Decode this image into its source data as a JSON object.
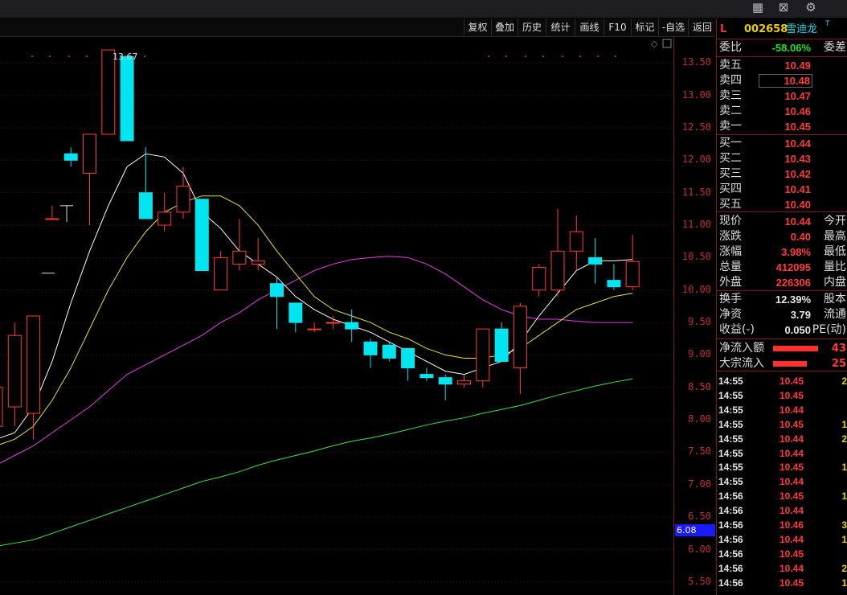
{
  "window": {
    "icons": [
      "grid-icon",
      "chart-icon",
      "settings-icon"
    ]
  },
  "toolbar": {
    "items": [
      "复权",
      "叠加",
      "历史",
      "统计",
      "画线",
      "F10",
      "标记",
      "-自选",
      "返回"
    ]
  },
  "chart": {
    "y_ticks": [
      "13.50",
      "13.00",
      "12.50",
      "12.00",
      "11.50",
      "11.00",
      "10.50",
      "10.00",
      "9.50",
      "9.00",
      "8.50",
      "8.00",
      "7.50",
      "7.00",
      "6.50",
      "6.00",
      "5.50"
    ],
    "max_label": "13.67",
    "crosshair_value": "6.08",
    "colors": {
      "up": "#ff3c3c",
      "down": "#00e5f0",
      "ma5": "#ffffff",
      "ma10": "#e8e040",
      "ma20": "#e040e0",
      "ma60": "#40e040"
    }
  },
  "chart_data": {
    "type": "candlestick",
    "ylim": [
      5.3,
      13.9
    ],
    "candles": [
      {
        "o": 7.9,
        "c": 8.5,
        "h": 8.8,
        "l": 7.8
      },
      {
        "o": 8.2,
        "c": 9.3,
        "h": 9.5,
        "l": 7.9
      },
      {
        "o": 8.1,
        "c": 9.6,
        "h": 9.6,
        "l": 7.7
      },
      {
        "o": 11.1,
        "c": 11.1,
        "h": 11.3,
        "l": 11.1
      },
      {
        "o": 12.1,
        "c": 12.0,
        "h": 12.2,
        "l": 11.9
      },
      {
        "o": 11.8,
        "c": 12.4,
        "h": 12.4,
        "l": 11.0
      },
      {
        "o": 12.4,
        "c": 13.7,
        "h": 13.7,
        "l": 12.4
      },
      {
        "o": 13.6,
        "c": 12.3,
        "h": 13.6,
        "l": 12.3
      },
      {
        "o": 11.5,
        "c": 11.1,
        "h": 12.2,
        "l": 11.1
      },
      {
        "o": 11.0,
        "c": 11.2,
        "h": 11.5,
        "l": 10.9
      },
      {
        "o": 11.2,
        "c": 11.6,
        "h": 11.9,
        "l": 11.1
      },
      {
        "o": 11.4,
        "c": 10.3,
        "h": 11.4,
        "l": 10.3
      },
      {
        "o": 10.0,
        "c": 10.5,
        "h": 10.6,
        "l": 10.0
      },
      {
        "o": 10.4,
        "c": 10.6,
        "h": 11.1,
        "l": 10.3
      },
      {
        "o": 10.4,
        "c": 10.45,
        "h": 10.8,
        "l": 10.3
      },
      {
        "o": 10.1,
        "c": 9.9,
        "h": 10.2,
        "l": 9.4
      },
      {
        "o": 9.8,
        "c": 9.5,
        "h": 9.8,
        "l": 9.35
      },
      {
        "o": 9.4,
        "c": 9.4,
        "h": 9.5,
        "l": 9.35
      },
      {
        "o": 9.5,
        "c": 9.5,
        "h": 9.6,
        "l": 9.4
      },
      {
        "o": 9.5,
        "c": 9.4,
        "h": 9.7,
        "l": 9.2
      },
      {
        "o": 9.2,
        "c": 9.0,
        "h": 9.25,
        "l": 8.8
      },
      {
        "o": 9.15,
        "c": 8.95,
        "h": 9.2,
        "l": 8.9
      },
      {
        "o": 9.1,
        "c": 8.8,
        "h": 9.1,
        "l": 8.6
      },
      {
        "o": 8.7,
        "c": 8.65,
        "h": 8.8,
        "l": 8.6
      },
      {
        "o": 8.65,
        "c": 8.55,
        "h": 8.7,
        "l": 8.3
      },
      {
        "o": 8.55,
        "c": 8.6,
        "h": 8.7,
        "l": 8.5
      },
      {
        "o": 8.6,
        "c": 9.4,
        "h": 9.4,
        "l": 8.5
      },
      {
        "o": 9.4,
        "c": 8.9,
        "h": 9.5,
        "l": 8.9
      },
      {
        "o": 8.8,
        "c": 9.75,
        "h": 9.8,
        "l": 8.4
      },
      {
        "o": 10.0,
        "c": 10.35,
        "h": 10.4,
        "l": 9.9
      },
      {
        "o": 10.0,
        "c": 10.6,
        "h": 11.25,
        "l": 9.9
      },
      {
        "o": 10.6,
        "c": 10.9,
        "h": 11.15,
        "l": 10.3
      },
      {
        "o": 10.5,
        "c": 10.4,
        "h": 10.8,
        "l": 10.1
      },
      {
        "o": 10.15,
        "c": 10.05,
        "h": 10.4,
        "l": 10.0
      },
      {
        "o": 10.05,
        "c": 10.44,
        "h": 10.85,
        "l": 10.0
      }
    ],
    "ma5": [
      7.7,
      7.8,
      8.2,
      8.9,
      9.8,
      10.6,
      11.3,
      11.9,
      12.1,
      12.05,
      11.8,
      11.2,
      10.95,
      10.6,
      10.4,
      10.2,
      9.9,
      9.7,
      9.55,
      9.45,
      9.35,
      9.2,
      9.05,
      8.9,
      8.75,
      8.7,
      8.8,
      8.9,
      9.2,
      9.6,
      9.95,
      10.3,
      10.45,
      10.45,
      10.47
    ],
    "ma10": [
      7.6,
      7.7,
      7.9,
      8.3,
      8.8,
      9.4,
      10.0,
      10.5,
      10.9,
      11.2,
      11.35,
      11.45,
      11.45,
      11.3,
      11.0,
      10.6,
      10.25,
      9.9,
      9.7,
      9.6,
      9.5,
      9.35,
      9.25,
      9.1,
      9.0,
      8.95,
      8.95,
      9.0,
      9.1,
      9.3,
      9.5,
      9.7,
      9.8,
      9.9,
      9.95
    ],
    "ma20": [
      7.3,
      7.45,
      7.6,
      7.8,
      8.0,
      8.2,
      8.45,
      8.7,
      8.85,
      9.0,
      9.15,
      9.3,
      9.5,
      9.65,
      9.85,
      10.0,
      10.15,
      10.3,
      10.4,
      10.47,
      10.5,
      10.52,
      10.5,
      10.4,
      10.25,
      10.05,
      9.85,
      9.7,
      9.6,
      9.55,
      9.55,
      9.52,
      9.5,
      9.5,
      9.5
    ],
    "ma60": [
      6.05,
      6.1,
      6.15,
      6.25,
      6.35,
      6.45,
      6.55,
      6.65,
      6.75,
      6.85,
      6.95,
      7.05,
      7.12,
      7.2,
      7.3,
      7.38,
      7.45,
      7.52,
      7.6,
      7.67,
      7.72,
      7.78,
      7.85,
      7.92,
      7.98,
      8.03,
      8.1,
      8.16,
      8.22,
      8.3,
      8.38,
      8.45,
      8.52,
      8.58,
      8.63
    ]
  },
  "panel": {
    "header": {
      "market": "L",
      "code": "002658",
      "name": "雪迪龙",
      "tag": "T"
    },
    "webi": {
      "label": "委比",
      "value": "-58.06%",
      "label2": "委差"
    },
    "sells": [
      {
        "label": "卖五",
        "price": "10.49"
      },
      {
        "label": "卖四",
        "price": "10.48"
      },
      {
        "label": "卖三",
        "price": "10.47"
      },
      {
        "label": "卖二",
        "price": "10.46"
      },
      {
        "label": "卖一",
        "price": "10.45"
      }
    ],
    "buys": [
      {
        "label": "买一",
        "price": "10.44"
      },
      {
        "label": "买二",
        "price": "10.43"
      },
      {
        "label": "买三",
        "price": "10.42"
      },
      {
        "label": "买四",
        "price": "10.41"
      },
      {
        "label": "买五",
        "price": "10.40"
      }
    ],
    "stats1": [
      {
        "label": "现价",
        "value": "10.44",
        "label2": "今开"
      },
      {
        "label": "涨跌",
        "value": "0.40",
        "label2": "最高"
      },
      {
        "label": "涨幅",
        "value": "3.98%",
        "label2": "最低"
      },
      {
        "label": "总量",
        "value": "412095",
        "label2": "量比"
      },
      {
        "label": "外盘",
        "value": "226306",
        "label2": "内盘"
      }
    ],
    "stats2": [
      {
        "label": "换手",
        "value": "12.39%",
        "label2": "股本"
      },
      {
        "label": "净资",
        "value": "3.79",
        "label2": "流通"
      },
      {
        "label": "收益(-)",
        "value": "0.050",
        "label2": "PE(动)"
      }
    ],
    "flows": [
      {
        "label": "净流入额",
        "value": "43"
      },
      {
        "label": "大宗流入",
        "value": "25"
      }
    ],
    "ticks": [
      {
        "time": "14:55",
        "price": "10.45",
        "vol": "2"
      },
      {
        "time": "14:55",
        "price": "10.45",
        "vol": ""
      },
      {
        "time": "14:55",
        "price": "10.44",
        "vol": ""
      },
      {
        "time": "14:55",
        "price": "10.45",
        "vol": "1"
      },
      {
        "time": "14:55",
        "price": "10.44",
        "vol": "2"
      },
      {
        "time": "14:55",
        "price": "10.44",
        "vol": ""
      },
      {
        "time": "14:55",
        "price": "10.45",
        "vol": "1"
      },
      {
        "time": "14:55",
        "price": "10.44",
        "vol": ""
      },
      {
        "time": "14:56",
        "price": "10.45",
        "vol": "1"
      },
      {
        "time": "14:56",
        "price": "10.44",
        "vol": ""
      },
      {
        "time": "14:56",
        "price": "10.46",
        "vol": "3"
      },
      {
        "time": "14:56",
        "price": "10.44",
        "vol": "1"
      },
      {
        "time": "14:56",
        "price": "10.45",
        "vol": ""
      },
      {
        "time": "14:56",
        "price": "10.44",
        "vol": "2"
      },
      {
        "time": "14:56",
        "price": "10.45",
        "vol": "1"
      }
    ]
  }
}
